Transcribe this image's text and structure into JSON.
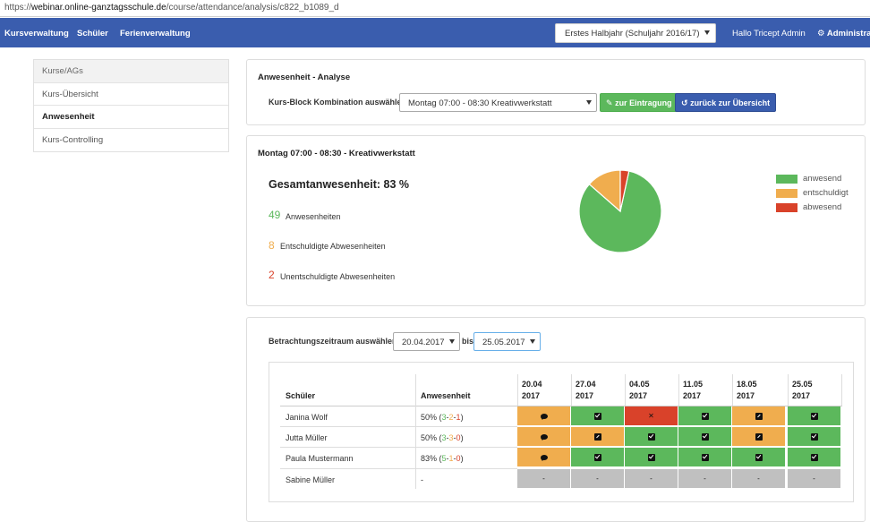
{
  "browser": {
    "url_scheme": "https://",
    "url_domain": "webinar.online-ganztagsschule.de",
    "url_path": "/course/attendance/analysis/c822_b1089_d"
  },
  "nav": {
    "items": [
      "Kursverwaltung",
      "Schüler",
      "Ferienverwaltung"
    ],
    "term": "Erstes Halbjahr (Schuljahr 2016/17)",
    "user": "Hallo Tricept Admin",
    "admin": "Administrati"
  },
  "sidebar": {
    "items": [
      {
        "label": "Kurse/AGs"
      },
      {
        "label": "Kurs-Übersicht"
      },
      {
        "label": "Anwesenheit"
      },
      {
        "label": "Kurs-Controlling"
      }
    ]
  },
  "analysis": {
    "title": "Anwesenheit - Analyse",
    "select_label": "Kurs-Block Kombination auswählen:",
    "select_value": "Montag 07:00 - 08:30 Kreativwerkstatt",
    "btn_entry": "zur Eintragung",
    "btn_back": "zurück zur Übersicht"
  },
  "summary": {
    "title": "Montag 07:00 - 08:30 - Kreativwerkstatt",
    "overall": "Gesamtanwesenheit: 83 %",
    "present_count": "49",
    "present_label": "Anwesenheiten",
    "excused_count": "8",
    "excused_label": "Entschuldigte Abwesenheiten",
    "unexcused_count": "2",
    "unexcused_label": "Unentschuldigte Abwesenheiten"
  },
  "chart_data": {
    "type": "pie",
    "title": "",
    "categories": [
      "anwesend",
      "entschuldigt",
      "abwesend"
    ],
    "values": [
      49,
      8,
      2
    ],
    "colors": [
      "#5cb85c",
      "#f0ad4e",
      "#d9422a"
    ],
    "legend_position": "right"
  },
  "period": {
    "label": "Betrachtungszeitraum auswählen:",
    "from": "20.04.2017",
    "to_label": "bis",
    "to": "25.05.2017"
  },
  "table": {
    "col_student": "Schüler",
    "col_attendance": "Anwesenheit",
    "dates": [
      {
        "d": "20.04",
        "y": "2017"
      },
      {
        "d": "27.04",
        "y": "2017"
      },
      {
        "d": "04.05",
        "y": "2017"
      },
      {
        "d": "11.05",
        "y": "2017"
      },
      {
        "d": "18.05",
        "y": "2017"
      },
      {
        "d": "25.05",
        "y": "2017"
      }
    ],
    "rows": [
      {
        "name": "Janina Wolf",
        "pct": "50%",
        "open": " (",
        "a": "3",
        "b": "2",
        "c": "1",
        "close": ")",
        "sep": "-",
        "cells": [
          [
            "orange",
            "comment-icon"
          ],
          [
            "green",
            "check-icon"
          ],
          [
            "red",
            "cross-icon"
          ],
          [
            "green",
            "check-icon"
          ],
          [
            "orange",
            "edit-icon"
          ],
          [
            "green",
            "check-icon"
          ]
        ]
      },
      {
        "name": "Jutta Müller",
        "pct": "50%",
        "open": " (",
        "a": "3",
        "b": "3",
        "c": "0",
        "close": ")",
        "sep": "-",
        "cells": [
          [
            "orange",
            "comment-icon"
          ],
          [
            "orange",
            "edit-icon"
          ],
          [
            "green",
            "check-icon"
          ],
          [
            "green",
            "check-icon"
          ],
          [
            "orange",
            "edit-icon"
          ],
          [
            "green",
            "check-icon"
          ]
        ]
      },
      {
        "name": "Paula Mustermann",
        "pct": "83%",
        "open": " (",
        "a": "5",
        "b": "1",
        "c": "0",
        "close": ")",
        "sep": "-",
        "cells": [
          [
            "orange",
            "comment-icon"
          ],
          [
            "green",
            "check-icon"
          ],
          [
            "green",
            "check-icon"
          ],
          [
            "green",
            "check-icon"
          ],
          [
            "green",
            "check-icon"
          ],
          [
            "green",
            "check-icon"
          ]
        ]
      },
      {
        "name": "Sabine Müller",
        "pct": "-",
        "open": "",
        "a": "",
        "b": "",
        "c": "",
        "close": "",
        "sep": "",
        "cells": [
          [
            "gray",
            "dash"
          ],
          [
            "gray",
            "dash"
          ],
          [
            "gray",
            "dash"
          ],
          [
            "gray",
            "dash"
          ],
          [
            "gray",
            "dash"
          ],
          [
            "gray",
            "dash"
          ]
        ]
      }
    ]
  }
}
